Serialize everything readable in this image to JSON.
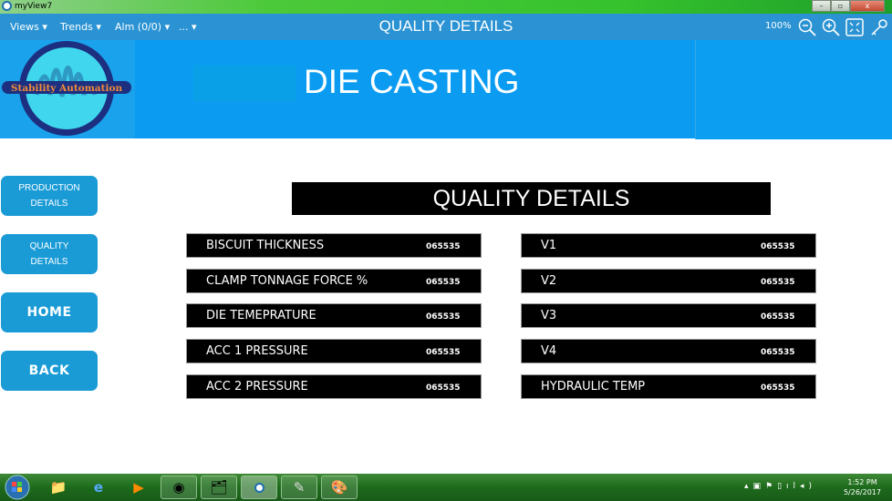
{
  "window": {
    "title": "myView7"
  },
  "toolbar": {
    "menus": [
      "Views ▾",
      "Trends ▾",
      "Alm (0/0) ▾",
      "... ▾"
    ],
    "title": "QUALITY DETAILS",
    "zoom": "100%",
    "icons": [
      "zoom-out-icon",
      "zoom-in-icon",
      "fullscreen-icon",
      "key-icon"
    ]
  },
  "banner": {
    "logo_text": "Stability Automation",
    "title": "DIE CASTING",
    "color": "#0b9cf2"
  },
  "nav": {
    "buttons": [
      {
        "line1": "PRODUCTION",
        "line2": "DETAILS"
      },
      {
        "line1": "QUALITY",
        "line2": "DETAILS"
      },
      {
        "label": "HOME"
      },
      {
        "label": "BACK"
      }
    ],
    "color": "#1a9bd6"
  },
  "main": {
    "title": "QUALITY DETAILS",
    "left": [
      {
        "label": "BISCUIT THICKNESS",
        "value": "065535"
      },
      {
        "label": "CLAMP TONNAGE FORCE %",
        "value": "065535"
      },
      {
        "label": "DIE TEMEPRATURE",
        "value": "065535"
      },
      {
        "label": "ACC 1 PRESSURE",
        "value": "065535"
      },
      {
        "label": "ACC 2 PRESSURE",
        "value": "065535"
      }
    ],
    "right": [
      {
        "label": "V1",
        "value": "065535"
      },
      {
        "label": "V2",
        "value": "065535"
      },
      {
        "label": "V3",
        "value": "065535"
      },
      {
        "label": "V4",
        "value": "065535"
      },
      {
        "label": "HYDRAULIC TEMP",
        "value": "065535"
      }
    ]
  },
  "taskbar": {
    "time": "1:52 PM",
    "date": "5/26/2017"
  }
}
